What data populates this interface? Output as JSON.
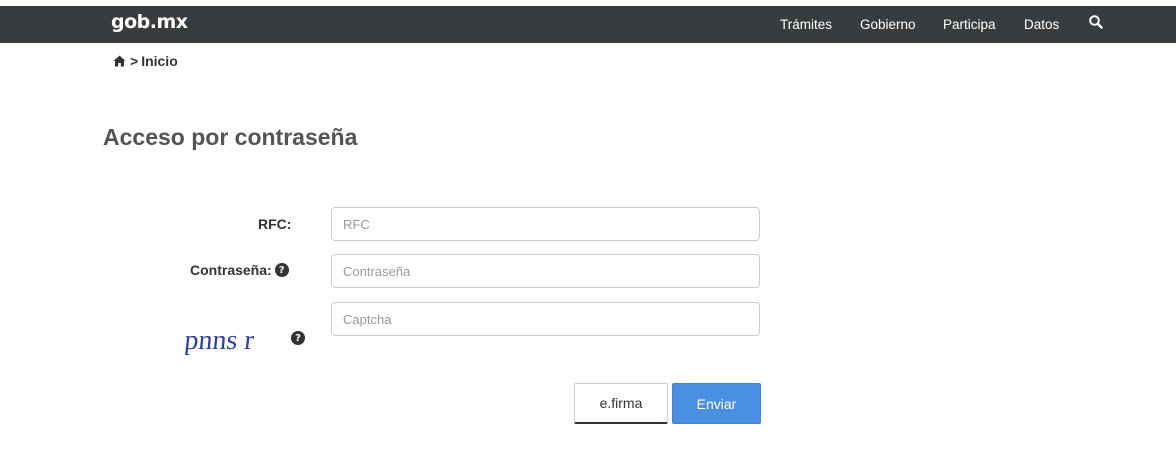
{
  "header": {
    "logo": "gob.mx",
    "nav": [
      "Trámites",
      "Gobierno",
      "Participa",
      "Datos"
    ]
  },
  "breadcrumb": {
    "separator": ">",
    "current": "Inicio"
  },
  "page": {
    "title": "Acceso por contraseña"
  },
  "form": {
    "rfc": {
      "label": "RFC:",
      "placeholder": "RFC",
      "value": ""
    },
    "password": {
      "label": "Contraseña:",
      "placeholder": "Contraseña",
      "value": ""
    },
    "captcha": {
      "image_text": "pnns r",
      "placeholder": "Captcha",
      "value": ""
    },
    "help_symbol": "?"
  },
  "buttons": {
    "efirma": "e.firma",
    "submit": "Enviar"
  },
  "colors": {
    "topbar": "#393c3e",
    "primary": "#4a90e2",
    "captcha": "#2b3f9e"
  },
  "icons": [
    "home-icon",
    "search-icon",
    "question-circle-icon"
  ]
}
